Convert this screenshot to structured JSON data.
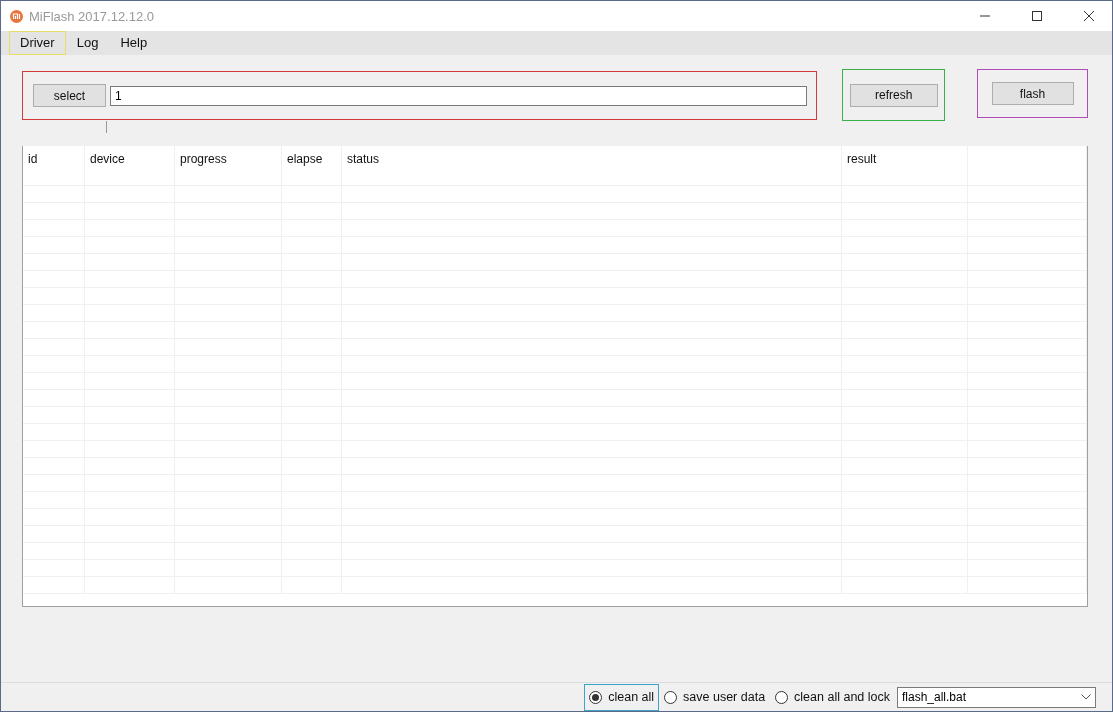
{
  "window": {
    "title": "MiFlash 2017.12.12.0"
  },
  "menu": [
    {
      "label": "Driver",
      "selected": true
    },
    {
      "label": "Log",
      "selected": false
    },
    {
      "label": "Help",
      "selected": false
    }
  ],
  "select_button": "select",
  "path_field": {
    "value": "1"
  },
  "refresh_button": "refresh",
  "flash_button": "flash",
  "table": {
    "columns": [
      "id",
      "device",
      "progress",
      "elapse",
      "status",
      "result"
    ]
  },
  "options": [
    {
      "label": "clean all",
      "selected": true
    },
    {
      "label": "save user data",
      "selected": false
    },
    {
      "label": "clean all and lock",
      "selected": false
    }
  ],
  "script_select": {
    "value": "flash_all.bat"
  }
}
